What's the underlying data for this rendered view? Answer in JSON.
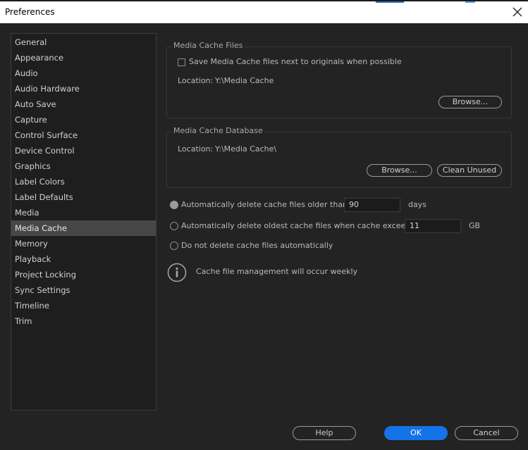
{
  "window": {
    "title": "Preferences"
  },
  "sidebar": {
    "items": [
      "General",
      "Appearance",
      "Audio",
      "Audio Hardware",
      "Auto Save",
      "Capture",
      "Control Surface",
      "Device Control",
      "Graphics",
      "Label Colors",
      "Label Defaults",
      "Media",
      "Media Cache",
      "Memory",
      "Playback",
      "Project Locking",
      "Sync Settings",
      "Timeline",
      "Trim"
    ],
    "selected": "Media Cache"
  },
  "media_cache_files": {
    "title": "Media Cache Files",
    "save_next_to_originals_label": "Save Media Cache files next to originals when possible",
    "save_next_to_originals_checked": false,
    "location_label": "Location:",
    "location_value": "Y:\\Media Cache",
    "browse_label": "Browse..."
  },
  "media_cache_database": {
    "title": "Media Cache Database",
    "location_label": "Location:",
    "location_value": "Y:\\Media Cache\\",
    "browse_label": "Browse...",
    "clean_unused_label": "Clean Unused"
  },
  "cache_options": {
    "delete_older_label": "Automatically delete cache files older than:",
    "delete_older_value": "90",
    "delete_older_unit": "days",
    "delete_oldest_label": "Automatically delete oldest cache files when cache exceeds:",
    "delete_oldest_value": "11",
    "delete_oldest_unit": "GB",
    "no_delete_label": "Do not delete cache files automatically",
    "selected": "delete_older"
  },
  "info": {
    "text": "Cache file management will occur weekly"
  },
  "footer": {
    "help_label": "Help",
    "ok_label": "OK",
    "cancel_label": "Cancel"
  },
  "colors": {
    "accent": "#1473e6",
    "background": "#232323"
  },
  "icons": {
    "close": "close-icon",
    "info": "info-icon"
  }
}
